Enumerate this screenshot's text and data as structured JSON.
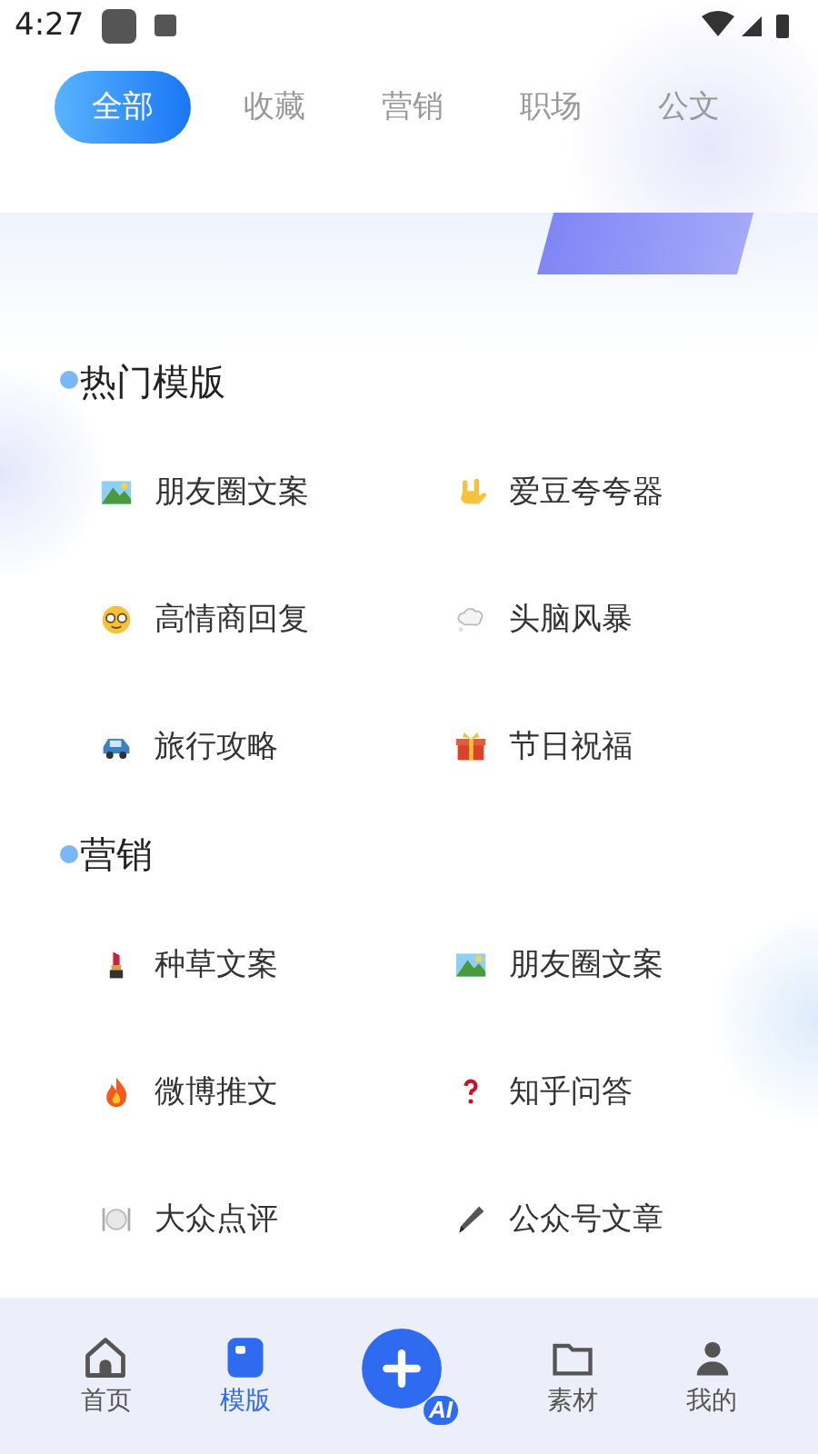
{
  "status_bar": {
    "time": "4:27"
  },
  "tabs": [
    {
      "label": "全部",
      "selected": true
    },
    {
      "label": "收藏",
      "selected": false
    },
    {
      "label": "营销",
      "selected": false
    },
    {
      "label": "职场",
      "selected": false
    },
    {
      "label": "公文",
      "selected": false
    }
  ],
  "sections": [
    {
      "title": "热门模版",
      "items": [
        {
          "label": "朋友圈文案",
          "kind": "landscape"
        },
        {
          "label": "爱豆夸夸器",
          "kind": "hand"
        },
        {
          "label": "高情商回复",
          "kind": "face"
        },
        {
          "label": "头脑风暴",
          "kind": "cloud"
        },
        {
          "label": "旅行攻略",
          "kind": "car"
        },
        {
          "label": "节日祝福",
          "kind": "gift"
        }
      ]
    },
    {
      "title": "营销",
      "items": [
        {
          "label": "种草文案",
          "kind": "lipstick"
        },
        {
          "label": "朋友圈文案",
          "kind": "landscape"
        },
        {
          "label": "微博推文",
          "kind": "fire"
        },
        {
          "label": "知乎问答",
          "kind": "question"
        },
        {
          "label": "大众点评",
          "kind": "plate"
        },
        {
          "label": "公众号文章",
          "kind": "pen"
        }
      ]
    }
  ],
  "bottom_nav": [
    {
      "label": "首页",
      "kind": "home",
      "selected": false
    },
    {
      "label": "模版",
      "kind": "template",
      "selected": true
    },
    {
      "kind": "ai",
      "badge": "AI"
    },
    {
      "label": "素材",
      "kind": "folder",
      "selected": false
    },
    {
      "label": "我的",
      "kind": "person",
      "selected": false
    }
  ]
}
